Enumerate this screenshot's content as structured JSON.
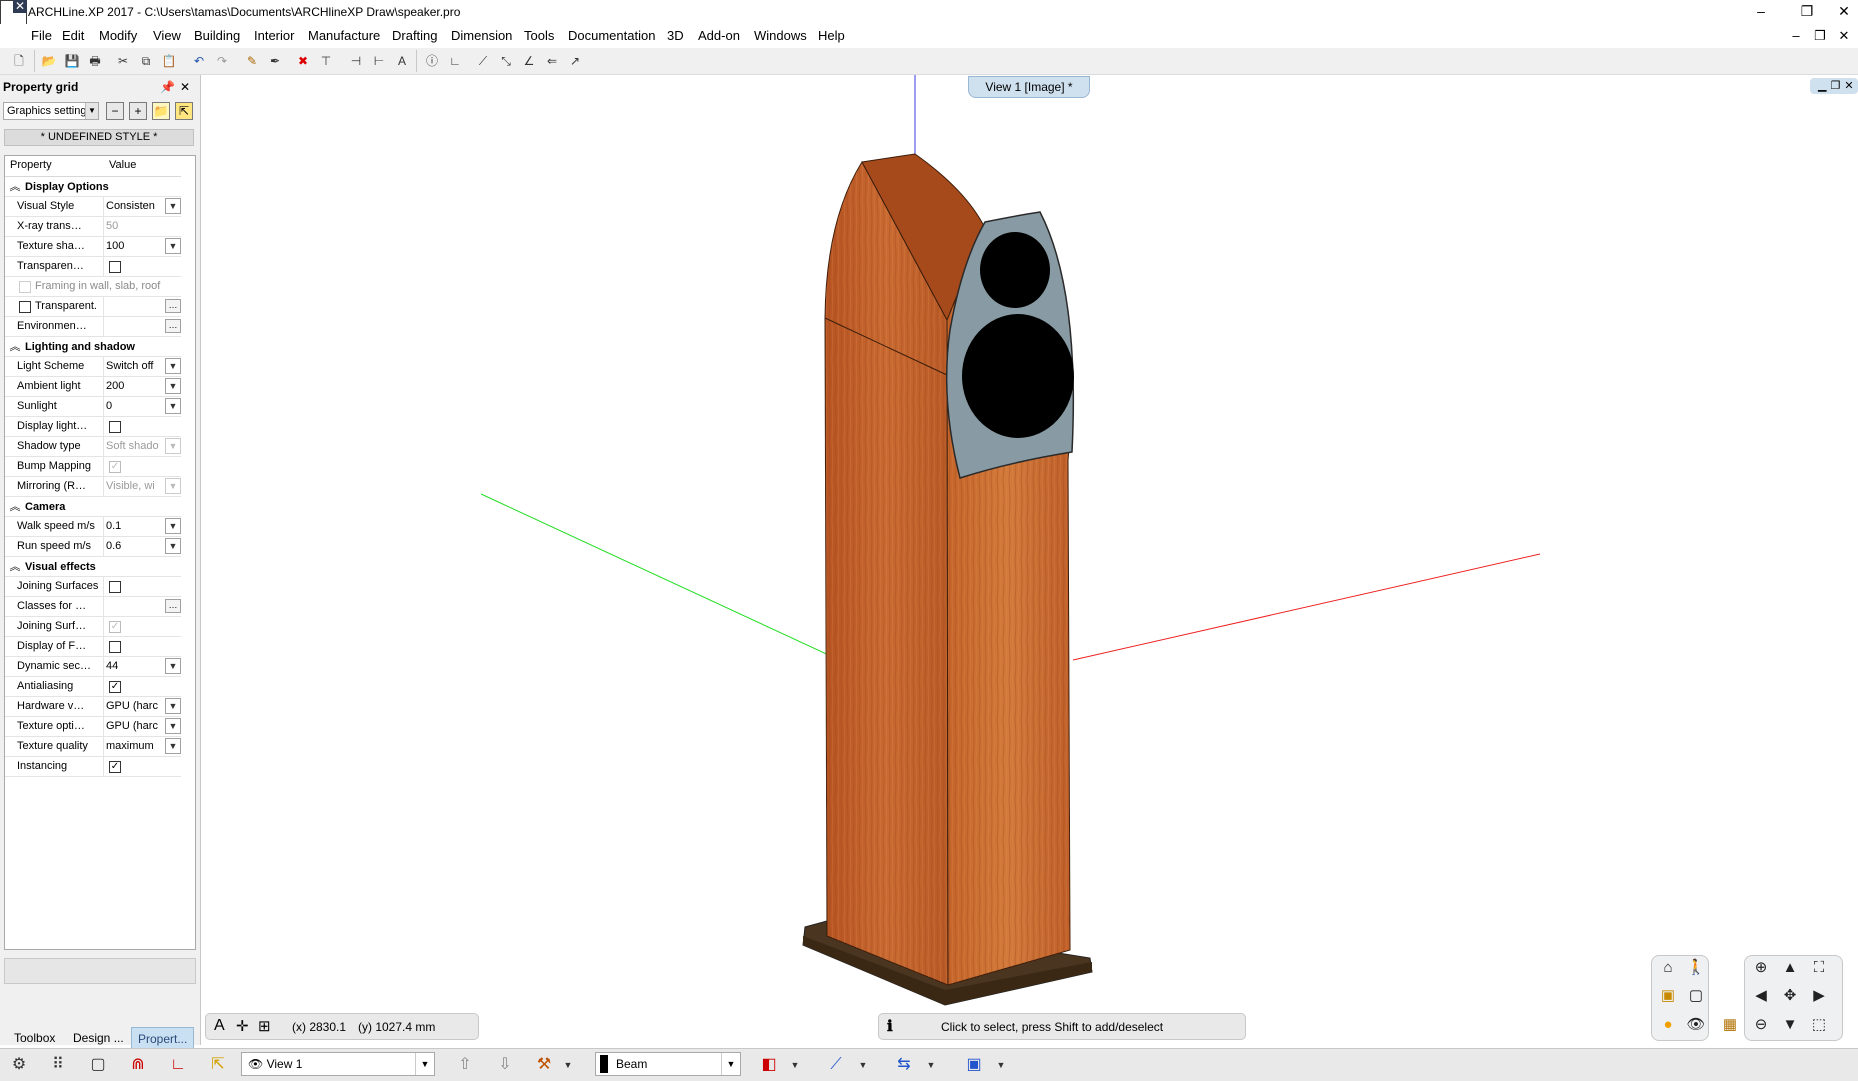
{
  "window": {
    "title": "ARCHLine.XP 2017 - C:\\Users\\tamas\\Documents\\ARCHlineXP Draw\\speaker.pro",
    "min": "–",
    "restore": "❐",
    "close": "✕"
  },
  "menu": [
    "File",
    "Edit",
    "Modify",
    "View",
    "Building",
    "Interior",
    "Manufacture",
    "Drafting",
    "Dimension",
    "Tools",
    "Documentation",
    "3D",
    "Add-on",
    "Windows",
    "Help"
  ],
  "property_grid": {
    "title": "Property grid",
    "settings_combo": "Graphics setting",
    "style": "* UNDEFINED STYLE *",
    "col_property": "Property",
    "col_value": "Value",
    "categories": {
      "display": "Display Options",
      "lighting": "Lighting and shadow",
      "camera": "Camera",
      "effects": "Visual effects"
    },
    "rows": {
      "visual_style": {
        "name": "Visual Style",
        "value": "Consisten"
      },
      "xray": {
        "name": "X-ray trans…",
        "value": "50"
      },
      "texture_sha": {
        "name": "Texture sha…",
        "value": "100"
      },
      "transparen": {
        "name": "Transparen…"
      },
      "framing": {
        "name": "Framing in wall, slab, roof"
      },
      "transparent": {
        "name": "Transparent."
      },
      "environmen": {
        "name": "Environmen…"
      },
      "light_scheme": {
        "name": "Light Scheme",
        "value": "Switch off"
      },
      "ambient": {
        "name": "Ambient light",
        "value": "200"
      },
      "sunlight": {
        "name": "Sunlight",
        "value": "0"
      },
      "display_light": {
        "name": "Display light…"
      },
      "shadow_type": {
        "name": "Shadow type",
        "value": "Soft shado"
      },
      "bump": {
        "name": "Bump Mapping"
      },
      "mirroring": {
        "name": "Mirroring (R…",
        "value": "Visible, wi"
      },
      "walk": {
        "name": "Walk speed m/s",
        "value": "0.1"
      },
      "run": {
        "name": "Run speed m/s",
        "value": "0.6"
      },
      "joining_surfaces": {
        "name": "Joining Surfaces"
      },
      "classes": {
        "name": "Classes for …"
      },
      "joining_surf": {
        "name": "Joining Surf…"
      },
      "display_of_f": {
        "name": "Display of F…"
      },
      "dynamic": {
        "name": "Dynamic sec…",
        "value": "44"
      },
      "antialiasing": {
        "name": "Antialiasing"
      },
      "hardware": {
        "name": "Hardware v…",
        "value": "GPU (harc"
      },
      "texture_opti": {
        "name": "Texture opti…",
        "value": "GPU (harc"
      },
      "texture_quality": {
        "name": "Texture quality",
        "value": "maximum"
      },
      "instancing": {
        "name": "Instancing"
      }
    }
  },
  "left_tabs": [
    "Toolbox",
    "Design ...",
    "Propert..."
  ],
  "viewport": {
    "tab": "View 1 [Image] *",
    "coord_x": "(x) 2830.1",
    "coord_y": "(y) 1027.4 mm",
    "status": "Click to select, press Shift to add/deselect",
    "axis_colors": {
      "x": "#ff0000",
      "y": "#00cc00",
      "z": "#0000cc"
    }
  },
  "bottom": {
    "view_combo": "View 1",
    "element_combo": "Beam"
  },
  "icons": {
    "toolbar": [
      "new-icon",
      "open-icon",
      "save-icon",
      "print-icon",
      "cut-icon",
      "copy-icon",
      "paste-icon",
      "undo-icon",
      "redo-icon",
      "eyedropper-icon",
      "pen-icon",
      "delete-icon",
      "trim-icon",
      "align-left-icon",
      "align-right-icon",
      "text-icon",
      "info-icon",
      "angle-icon",
      "measure-icon",
      "distance-icon",
      "bisect-icon",
      "direction-icon"
    ]
  }
}
